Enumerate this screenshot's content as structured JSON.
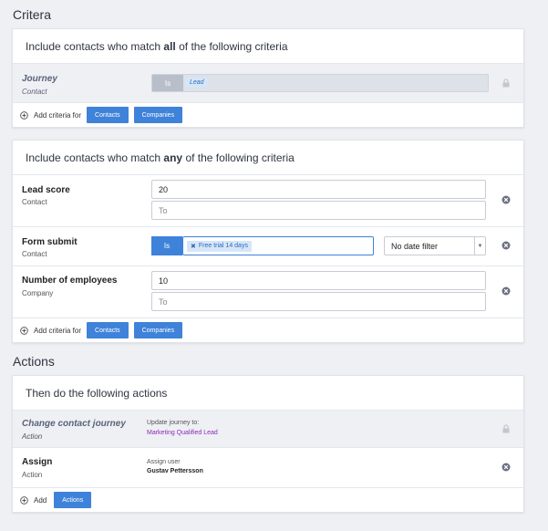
{
  "criteria_section": {
    "title": "Critera"
  },
  "all_card": {
    "intro_prefix": "Include contacts who match ",
    "intro_keyword": "all",
    "intro_suffix": " of the following criteria",
    "rows": [
      {
        "name": "Journey",
        "type": "Contact",
        "operator": "Is",
        "value": "Lead",
        "locked": true
      }
    ],
    "footer": {
      "label": "Add criteria for",
      "buttons": [
        "Contacts",
        "Companies"
      ]
    }
  },
  "any_card": {
    "intro_prefix": "Include contacts who match ",
    "intro_keyword": "any",
    "intro_suffix": " of the following criteria",
    "lead_score": {
      "name": "Lead score",
      "type": "Contact",
      "from_value": "20",
      "to_placeholder": "To"
    },
    "form_submit": {
      "name": "Form submit",
      "type": "Contact",
      "operator": "Is",
      "tag": "Free trial 14 days",
      "date_filter": "No date filter"
    },
    "employees": {
      "name": "Number of employees",
      "type": "Company",
      "from_value": "10",
      "to_placeholder": "To"
    },
    "footer": {
      "label": "Add criteria for",
      "buttons": [
        "Contacts",
        "Companies"
      ]
    }
  },
  "actions_section": {
    "title": "Actions"
  },
  "actions_card": {
    "intro": "Then do the following actions",
    "change_journey": {
      "name": "Change contact journey",
      "type": "Action",
      "detail_label": "Update journey to:",
      "detail_value": "Marketing Qualified Lead"
    },
    "assign": {
      "name": "Assign",
      "type": "Action",
      "detail_label": "Assign user",
      "detail_value": "Gustav Pettersson"
    },
    "footer": {
      "label": "Add",
      "button": "Actions"
    }
  },
  "colors": {
    "accent": "#3f82d9",
    "journey_value": "#8a2ab8",
    "locked_bg": "#eef0f4"
  },
  "icons": {
    "lock": "lock-icon",
    "remove": "close-icon",
    "add": "plus-circle-icon"
  }
}
